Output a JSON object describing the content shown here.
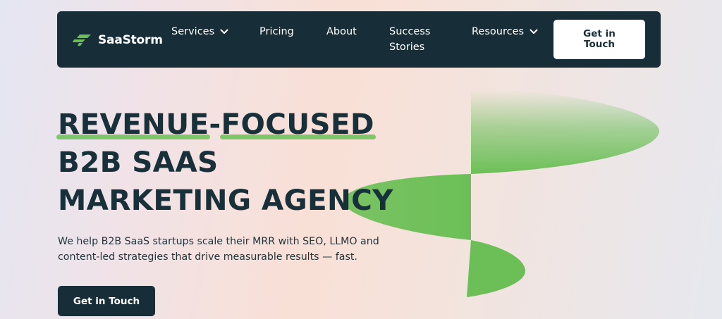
{
  "brand": {
    "name": "SaaStorm",
    "logo_icon": "storm-logo-icon",
    "color_primary": "#172e38",
    "color_accent": "#6cbf57"
  },
  "nav": {
    "items": [
      {
        "label": "Services",
        "has_dropdown": true,
        "icon": "chevron-down-icon"
      },
      {
        "label": "Pricing",
        "has_dropdown": false
      },
      {
        "label": "About",
        "has_dropdown": false
      },
      {
        "label_line1": "Success",
        "label_line2": "Stories",
        "has_dropdown": false
      },
      {
        "label": "Resources",
        "has_dropdown": true,
        "icon": "chevron-down-icon"
      }
    ],
    "cta_line1": "Get in",
    "cta_line2": "Touch"
  },
  "hero": {
    "title_word1": "REVENUE",
    "title_dash": "-",
    "title_word2": "FOCUSED",
    "title_line2": "B2B SAAS",
    "title_line3": "MARKETING AGENCY",
    "description_line1": "We help B2B SaaS startups scale their MRR with SEO, LLMO and",
    "description_line2": "content-led strategies that drive measurable results — fast.",
    "cta_label": "Get in Touch"
  }
}
